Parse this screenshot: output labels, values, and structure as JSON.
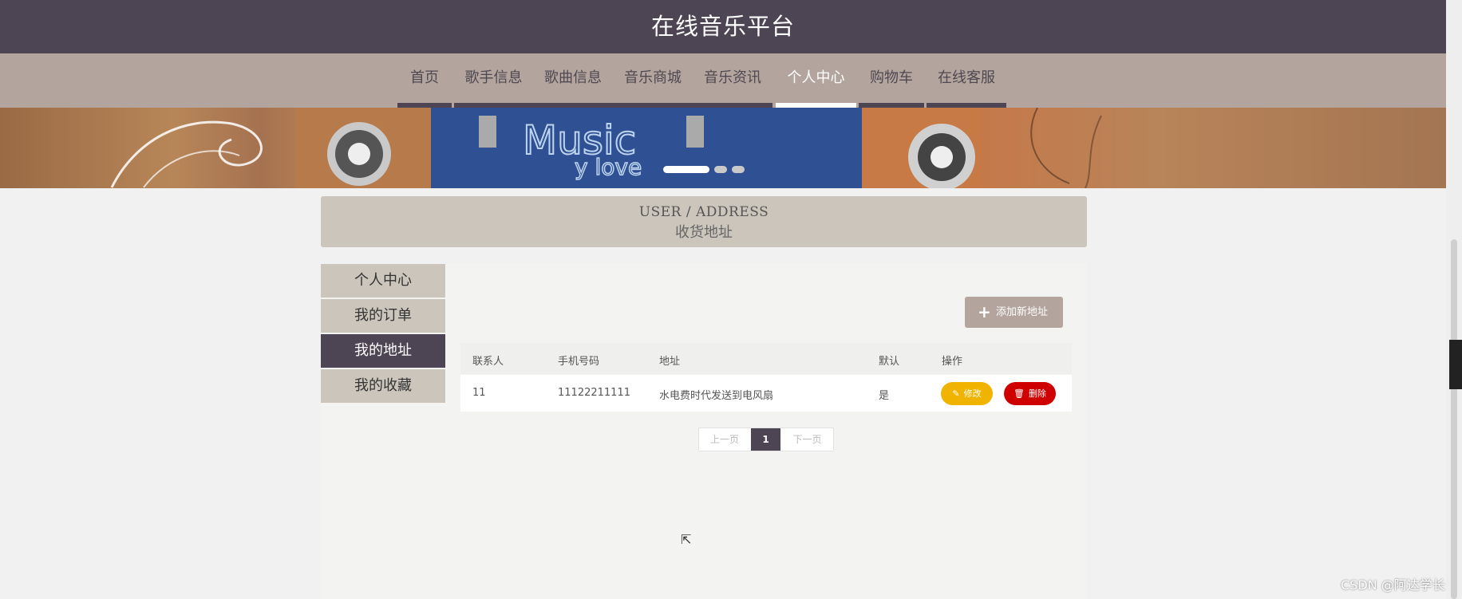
{
  "site": {
    "title": "在线音乐平台"
  },
  "nav": [
    {
      "label": "首页",
      "active": false
    },
    {
      "label": "歌手信息",
      "active": false
    },
    {
      "label": "歌曲信息",
      "active": false
    },
    {
      "label": "音乐商城",
      "active": false
    },
    {
      "label": "音乐资讯",
      "active": false
    },
    {
      "label": "个人中心",
      "active": true
    },
    {
      "label": "购物车",
      "active": false
    },
    {
      "label": "在线客服",
      "active": false
    }
  ],
  "banner": {
    "art_text_1": "Music",
    "art_text_2": "y love",
    "slides": 3,
    "active_slide": 1
  },
  "breadcrumb": {
    "en": "USER / ADDRESS",
    "zh": "收货地址"
  },
  "sidebar": [
    {
      "label": "个人中心",
      "active": false
    },
    {
      "label": "我的订单",
      "active": false
    },
    {
      "label": "我的地址",
      "active": true
    },
    {
      "label": "我的收藏",
      "active": false
    }
  ],
  "actions": {
    "add_address": "添加新地址"
  },
  "table": {
    "headers": [
      "联系人",
      "手机号码",
      "地址",
      "默认",
      "操作"
    ],
    "rows": [
      {
        "contact": "11",
        "phone": "11122211111",
        "address": "水电费时代发送到电风扇",
        "default": "是",
        "edit": "修改",
        "delete": "删除"
      }
    ]
  },
  "pagination": {
    "prev": "上一页",
    "current": "1",
    "next": "下一页"
  },
  "watermark": "CSDN @阿达学长",
  "colors": {
    "header": "#4d4553",
    "nav": "#b3a59e",
    "panel": "#ccc5bc",
    "edit": "#f0b400",
    "delete": "#cf0000"
  }
}
